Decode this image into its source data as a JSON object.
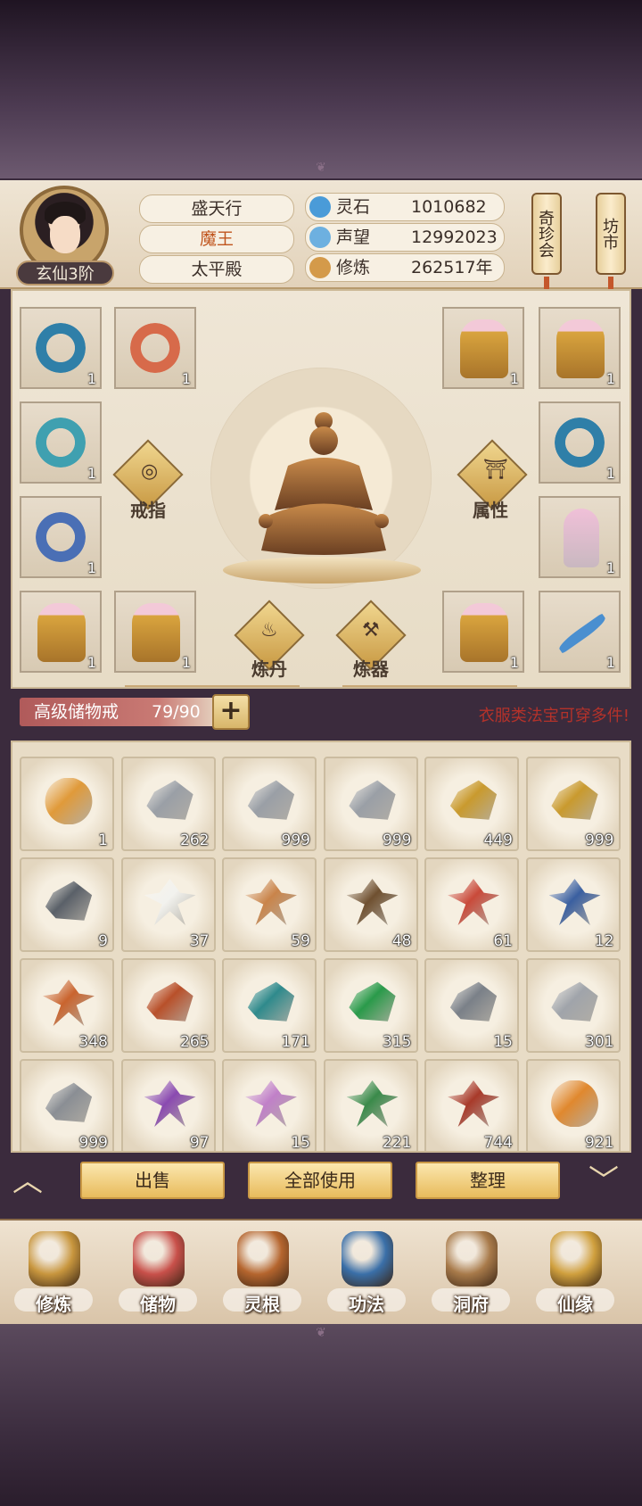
{
  "header": {
    "rank": "玄仙3阶",
    "names": [
      "盛天行",
      "魔王",
      "太平殿"
    ],
    "stats": [
      {
        "icon": "spirit-stone-icon",
        "label": "灵石",
        "value": "1010682",
        "color": "#4a9bd8"
      },
      {
        "icon": "reputation-icon",
        "label": "声望",
        "value": "12992023",
        "color": "#6db0e0"
      },
      {
        "icon": "cultivation-icon",
        "label": "修炼",
        "value": "262517年",
        "color": "#d49a4a"
      }
    ],
    "buttons": [
      "奇珍会",
      "坊市"
    ]
  },
  "equipment": {
    "left_slots": [
      {
        "icon": "ring-icon",
        "count": "1",
        "color": "#2f7fa8"
      },
      {
        "icon": "ring-icon",
        "count": "1",
        "color": "#d76a4a"
      },
      {
        "icon": "ring-icon",
        "count": "1",
        "color": "#3fa0b0"
      },
      {
        "icon": "ring-icon",
        "count": "1",
        "color": "#4a6fb5"
      },
      {
        "icon": "robe-icon",
        "count": "1",
        "color": "#d9a43e"
      },
      {
        "icon": "robe-icon",
        "count": "1",
        "color": "#d9a43e"
      }
    ],
    "right_slots": [
      {
        "icon": "robe-icon",
        "count": "1",
        "color": "#d9a43e"
      },
      {
        "icon": "robe-icon",
        "count": "1",
        "color": "#d9a43e"
      },
      {
        "icon": "ring-icon",
        "count": "1",
        "color": "#2f7fa8"
      },
      {
        "icon": "sword-hilt-icon",
        "count": "1",
        "color": "#c9b8c0"
      },
      {
        "icon": "robe-icon",
        "count": "1",
        "color": "#d9a43e"
      },
      {
        "icon": "blade-icon",
        "count": "1",
        "color": "#4a8fd0"
      }
    ],
    "functions": [
      "戒指",
      "属性",
      "炼丹",
      "炼器"
    ]
  },
  "bag": {
    "name": "高级储物戒",
    "capacity": "79/90",
    "plus": "+",
    "note": "衣服类法宝可穿多件!"
  },
  "items": [
    {
      "icon": "orb-icon",
      "count": "1",
      "color": "#e09a3a"
    },
    {
      "icon": "ore-icon",
      "count": "262",
      "color": "#9a9fa6"
    },
    {
      "icon": "ore-icon",
      "count": "999",
      "color": "#9a9fa6"
    },
    {
      "icon": "ore-icon",
      "count": "999",
      "color": "#9a9fa6"
    },
    {
      "icon": "gold-ore-icon",
      "count": "449",
      "color": "#c99a2e"
    },
    {
      "icon": "gold-ore-icon",
      "count": "999",
      "color": "#c99a2e"
    },
    {
      "icon": "dark-ore-icon",
      "count": "9",
      "color": "#5a6068"
    },
    {
      "icon": "white-flower-icon",
      "count": "37",
      "color": "#f2f2ee"
    },
    {
      "icon": "ginseng-icon",
      "count": "59",
      "color": "#c9844a"
    },
    {
      "icon": "herb-root-icon",
      "count": "48",
      "color": "#6f5030"
    },
    {
      "icon": "red-herb-icon",
      "count": "61",
      "color": "#c94a3a"
    },
    {
      "icon": "berry-branch-icon",
      "count": "12",
      "color": "#3a5fa0"
    },
    {
      "icon": "centipede-icon",
      "count": "348",
      "color": "#c9642e"
    },
    {
      "icon": "red-crystal-icon",
      "count": "265",
      "color": "#b8502a"
    },
    {
      "icon": "teal-crystal-icon",
      "count": "171",
      "color": "#2f8a8c"
    },
    {
      "icon": "green-crystal-icon",
      "count": "315",
      "color": "#2a9a4a"
    },
    {
      "icon": "silver-ore-icon",
      "count": "15",
      "color": "#7a8088"
    },
    {
      "icon": "silver-ore-icon",
      "count": "301",
      "color": "#a0a4aa"
    },
    {
      "icon": "silver-ore-icon",
      "count": "999",
      "color": "#8a8e94"
    },
    {
      "icon": "purple-berry-icon",
      "count": "97",
      "color": "#8a4ab0"
    },
    {
      "icon": "lavender-icon",
      "count": "15",
      "color": "#c080c8"
    },
    {
      "icon": "green-bush-icon",
      "count": "221",
      "color": "#3a8a4a"
    },
    {
      "icon": "red-coral-icon",
      "count": "744",
      "color": "#a83a2a"
    },
    {
      "icon": "seed-pod-icon",
      "count": "921",
      "color": "#e0882e"
    }
  ],
  "actions": [
    "出售",
    "全部使用",
    "整理"
  ],
  "nav": [
    {
      "label": "修炼",
      "icon": "cultivate-icon",
      "color": "#c8963e"
    },
    {
      "label": "储物",
      "icon": "bag-icon",
      "color": "#c8504a"
    },
    {
      "label": "灵根",
      "icon": "spirit-root-icon",
      "color": "#b5652e"
    },
    {
      "label": "功法",
      "icon": "book-icon",
      "color": "#3a6fa8"
    },
    {
      "label": "洞府",
      "icon": "cave-house-icon",
      "color": "#a87a4a"
    },
    {
      "label": "仙缘",
      "icon": "gourd-icon",
      "color": "#d0a03e"
    }
  ]
}
